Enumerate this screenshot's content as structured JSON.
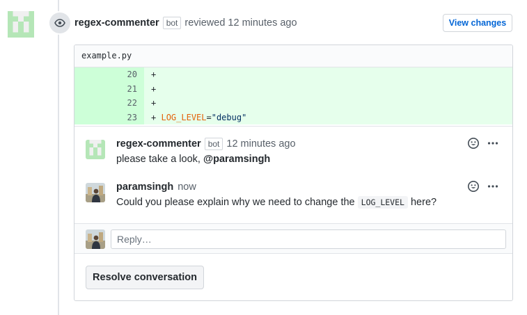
{
  "review": {
    "author": "regex-commenter",
    "bot_label": "bot",
    "action": "reviewed",
    "time": "12 minutes ago",
    "view_changes_label": "View changes"
  },
  "file": {
    "name": "example.py",
    "lines": [
      {
        "num": "20",
        "prefix": "+",
        "var": "",
        "op": "",
        "str": ""
      },
      {
        "num": "21",
        "prefix": "+",
        "var": "",
        "op": "",
        "str": ""
      },
      {
        "num": "22",
        "prefix": "+",
        "var": "",
        "op": "",
        "str": ""
      },
      {
        "num": "23",
        "prefix": "+",
        "var": "LOG_LEVEL",
        "op": "=",
        "str": "\"debug\""
      }
    ]
  },
  "comments": [
    {
      "author": "regex-commenter",
      "bot_label": "bot",
      "time": "12 minutes ago",
      "text": "please take a look, ",
      "mention": "@paramsingh"
    },
    {
      "author": "paramsingh",
      "time": "now",
      "text_before": "Could you please explain why we need to change the ",
      "code": "LOG_LEVEL",
      "text_after": " here?"
    }
  ],
  "reply": {
    "placeholder": "Reply…"
  },
  "resolve_label": "Resolve conversation",
  "colors": {
    "added_bg": "#e6ffec",
    "added_num_bg": "#cdffd8",
    "identicon": "#b5e6b7",
    "link": "#0366d6"
  }
}
